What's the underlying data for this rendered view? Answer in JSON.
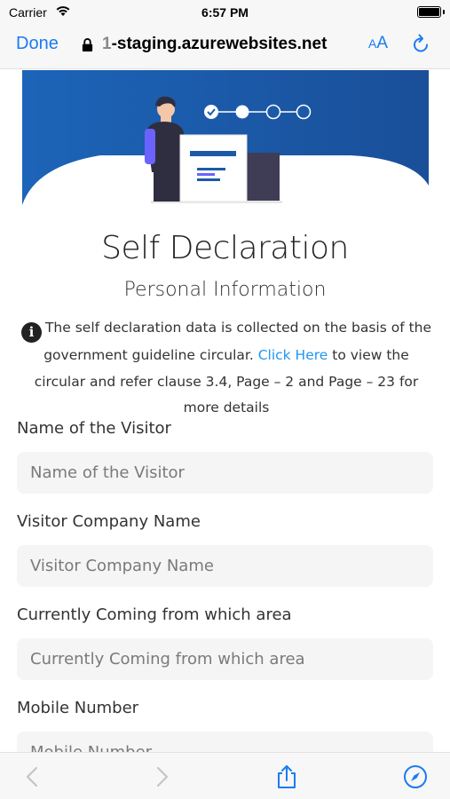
{
  "status_bar": {
    "carrier": "Carrier",
    "time": "6:57 PM"
  },
  "browser": {
    "done_label": "Done",
    "url_prefix": "1",
    "url_rest": "-staging.azurewebsites.net",
    "text_size_small": "A",
    "text_size_big": "A",
    "accent_color": "#1a7cf0"
  },
  "hero": {
    "banner_color": "#1f5fae",
    "progress_steps": 4,
    "progress_completed": 1,
    "progress_current": 2
  },
  "page": {
    "title": "Self Declaration",
    "subtitle": "Personal Information",
    "info_icon": "i",
    "info_text_before": "The self declaration data is collected on the basis of the government guideline circular. ",
    "info_link": "Click Here",
    "info_text_after": " to view the circular and refer clause 3.4, Page – 2 and Page – 23 for more details",
    "link_color": "#2196f3"
  },
  "form": {
    "fields": [
      {
        "label": "Name of the Visitor",
        "placeholder": "Name of the Visitor",
        "value": ""
      },
      {
        "label": "Visitor Company Name",
        "placeholder": "Visitor Company Name",
        "value": ""
      },
      {
        "label": "Currently Coming from which area",
        "placeholder": "Currently Coming from which area",
        "value": ""
      },
      {
        "label": "Mobile Number",
        "placeholder": "Mobile Number",
        "value": ""
      }
    ]
  },
  "toolbar": {
    "icons": [
      "back-icon",
      "forward-icon",
      "share-icon",
      "compass-icon"
    ]
  }
}
